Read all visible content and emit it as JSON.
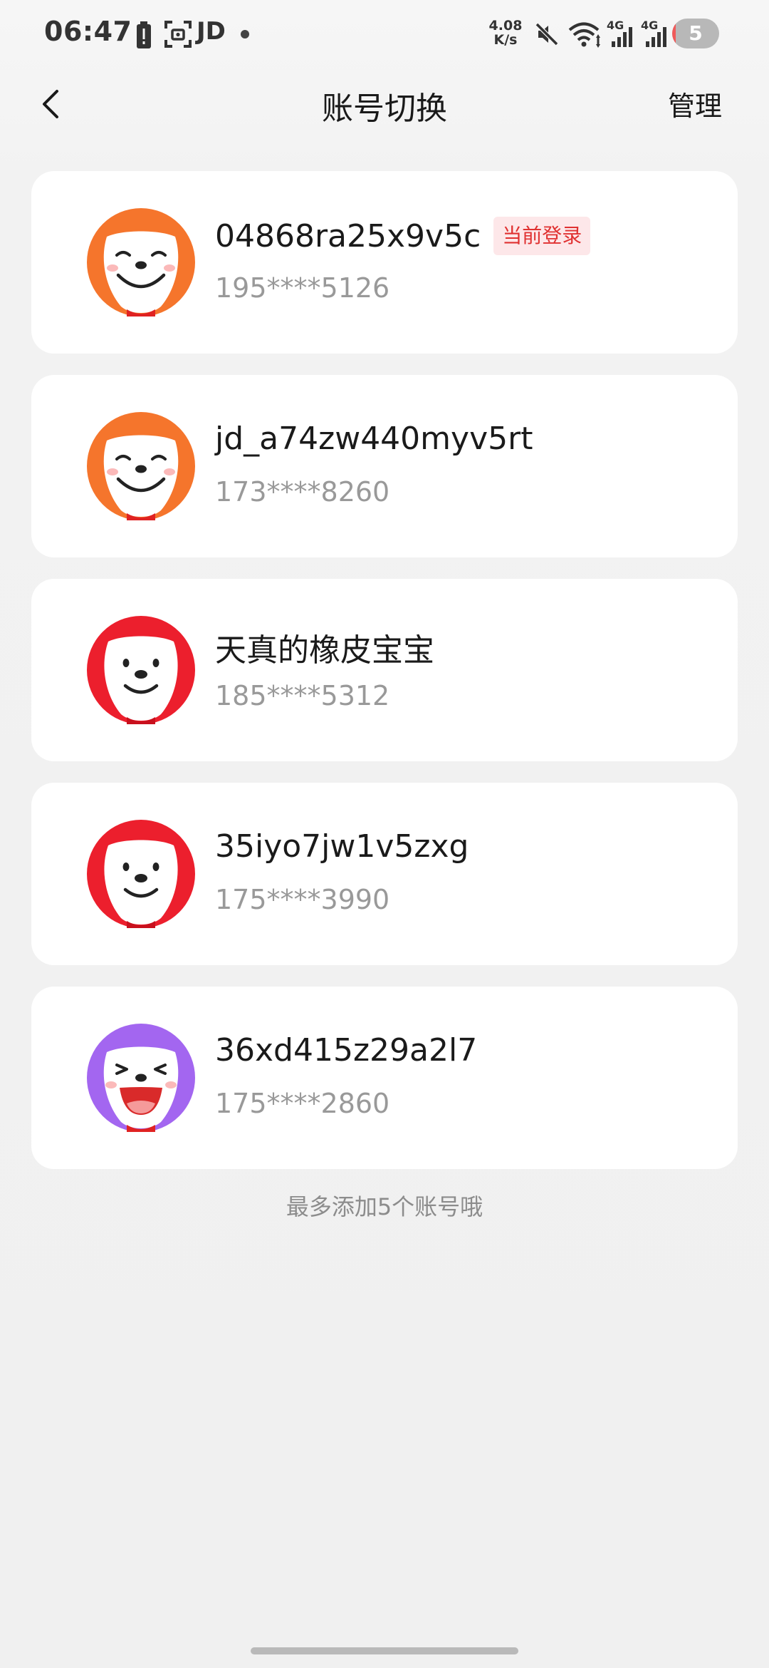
{
  "status_bar": {
    "time": "06:47",
    "carrier_text": "JD",
    "net_speed_value": "4.08",
    "net_speed_unit": "K/s",
    "signal_1_label": "4G",
    "signal_2_label": "4G",
    "battery_level": "5",
    "icons": [
      "battery-alert-icon",
      "screenshot-scan-icon",
      "mute-icon",
      "wifi-icon",
      "signal-icon",
      "signal-icon"
    ]
  },
  "header": {
    "back_icon": "chevron-left-icon",
    "title": "账号切换",
    "manage_label": "管理"
  },
  "accounts": [
    {
      "name": "04868ra25x9v5c",
      "phone": "195****5126",
      "badge": "当前登录",
      "avatar": "orange-smiling-dog-avatar",
      "avatar_color": "#f5752c"
    },
    {
      "name": "jd_a74zw440myv5rt",
      "phone": "173****8260",
      "badge": "",
      "avatar": "orange-smiling-dog-avatar",
      "avatar_color": "#f5752c"
    },
    {
      "name": "天真的橡皮宝宝",
      "phone": "185****5312",
      "badge": "",
      "avatar": "red-dog-avatar",
      "avatar_color": "#ec1f2d"
    },
    {
      "name": "35iyo7jw1v5zxg",
      "phone": "175****3990",
      "badge": "",
      "avatar": "red-dog-avatar",
      "avatar_color": "#ec1f2d"
    },
    {
      "name": "36xd415z29a2l7",
      "phone": "175****2860",
      "badge": "",
      "avatar": "purple-laughing-dog-avatar",
      "avatar_color": "#a366f0"
    }
  ],
  "limit_note": "最多添加5个账号哦",
  "colors": {
    "badge_text": "#e03131",
    "badge_bg": "#fde7e9",
    "background": "#f2f2f2",
    "card": "#ffffff"
  }
}
